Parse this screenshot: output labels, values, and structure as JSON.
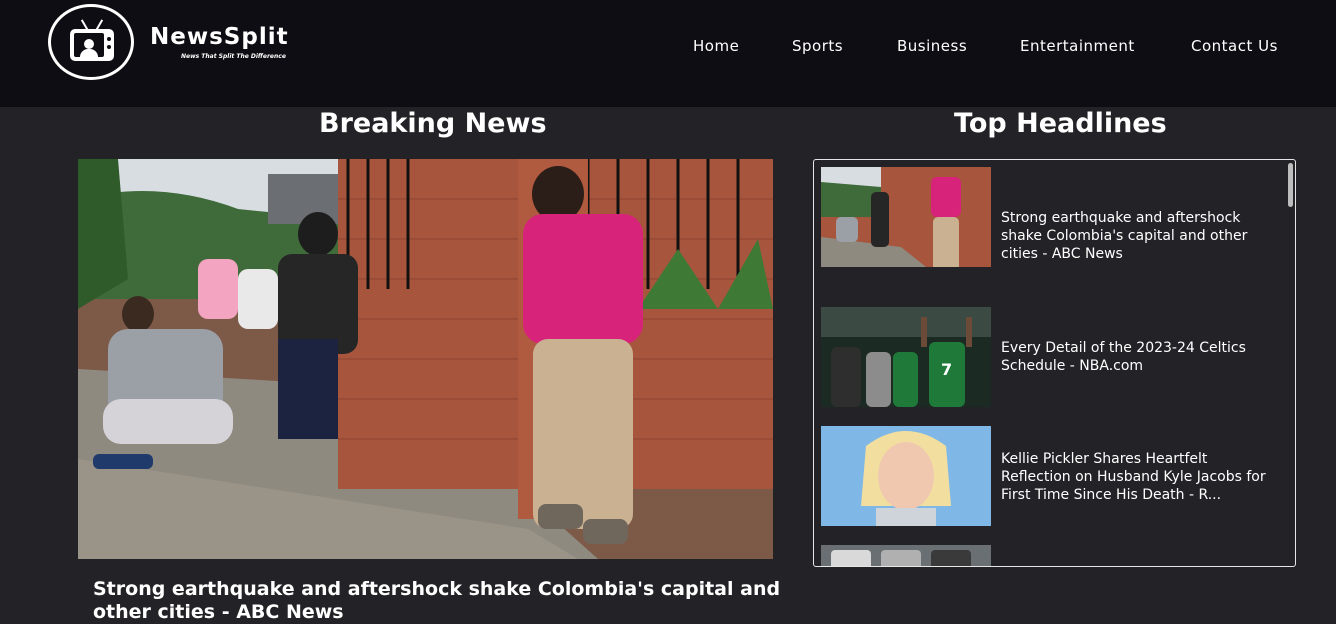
{
  "brand": {
    "name": "NewsSplit",
    "tagline": "News That Split The Difference"
  },
  "nav": {
    "items": [
      {
        "label": "Home"
      },
      {
        "label": "Sports"
      },
      {
        "label": "Business"
      },
      {
        "label": "Entertainment"
      },
      {
        "label": "Contact Us"
      }
    ]
  },
  "breaking": {
    "section_title": "Breaking News",
    "headline": "Strong earthquake and aftershock shake Colombia's capital and other cities - ABC News"
  },
  "top": {
    "section_title": "Top Headlines",
    "items": [
      {
        "title": "Strong earthquake and aftershock shake Colombia's capital and other cities - ABC News"
      },
      {
        "title": "Every Detail of the 2023-24 Celtics Schedule - NBA.com"
      },
      {
        "title": "Kellie Pickler Shares Heartfelt Reflection on Husband Kyle Jacobs for First Time Since His Death - R..."
      },
      {
        "title": ""
      }
    ]
  },
  "colors": {
    "header_bg": "#0e0d13",
    "page_bg": "#232327",
    "text": "#ffffff",
    "accent_pink": "#d8237a",
    "celtics_green": "#1f7a3a"
  }
}
